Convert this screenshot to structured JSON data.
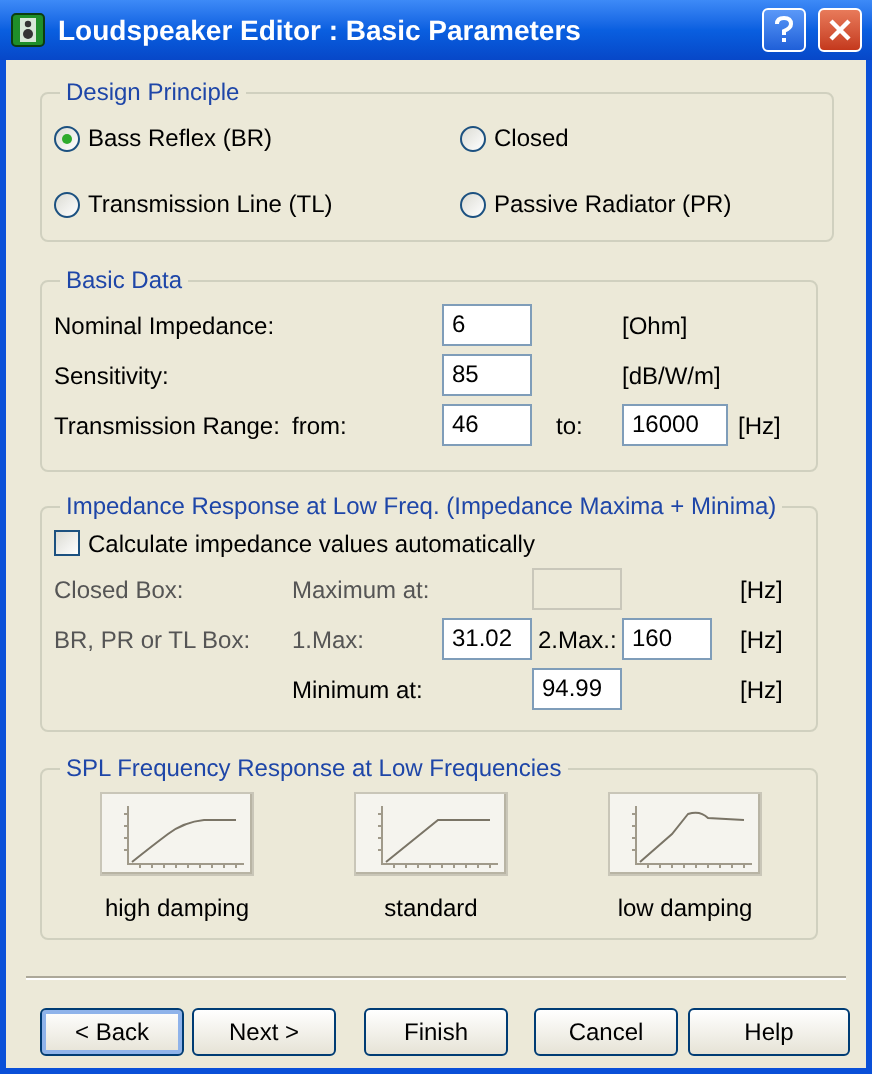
{
  "window": {
    "title": "Loudspeaker Editor :  Basic Parameters"
  },
  "design_principle": {
    "title": "Design Principle",
    "options": [
      {
        "label": "Bass Reflex (BR)",
        "selected": true
      },
      {
        "label": "Closed",
        "selected": false
      },
      {
        "label": "Transmission Line (TL)",
        "selected": false
      },
      {
        "label": "Passive Radiator (PR)",
        "selected": false
      }
    ]
  },
  "basic_data": {
    "title": "Basic Data",
    "rows": [
      {
        "label": "Nominal Impedance:",
        "value": "6",
        "unit": "[Ohm]"
      },
      {
        "label": "Sensitivity:",
        "value": "85",
        "unit": "[dB/W/m]"
      },
      {
        "label": "Transmission Range:",
        "from_label": "from:",
        "value": "46",
        "to_label": "to:",
        "to_value": "16000",
        "unit": "[Hz]"
      }
    ]
  },
  "impedance": {
    "title": "Impedance Response at Low Freq. (Impedance Maxima + Minima)",
    "auto_calculate": {
      "label": "Calculate impedance values automatically",
      "checked": false
    },
    "rows": [
      {
        "kind": "closed",
        "label": "Closed Box:",
        "field_label": "Maximum at:",
        "disabled": true,
        "unit": "[Hz]"
      },
      {
        "kind": "two",
        "label": "BR, PR or TL Box:",
        "field_label": "1.Max:",
        "value": "31.02",
        "second_label": "2.Max.:",
        "second_value": "160",
        "unit": "[Hz]"
      },
      {
        "kind": "minimum",
        "field_label": "Minimum at:",
        "value": "94.99",
        "unit": "[Hz]"
      }
    ]
  },
  "spl_response": {
    "title": "SPL Frequency Response at Low Frequencies",
    "options": [
      {
        "kind": "high",
        "label": "high damping"
      },
      {
        "kind": "standard",
        "label": "standard"
      },
      {
        "kind": "low",
        "label": "low damping"
      }
    ]
  },
  "buttons": [
    {
      "label": "< Back",
      "focused": true
    },
    {
      "label": "Next >",
      "focused": false
    },
    {
      "label": "Finish",
      "focused": false
    },
    {
      "label": "Cancel",
      "focused": false
    },
    {
      "label": "Help",
      "focused": false
    }
  ]
}
